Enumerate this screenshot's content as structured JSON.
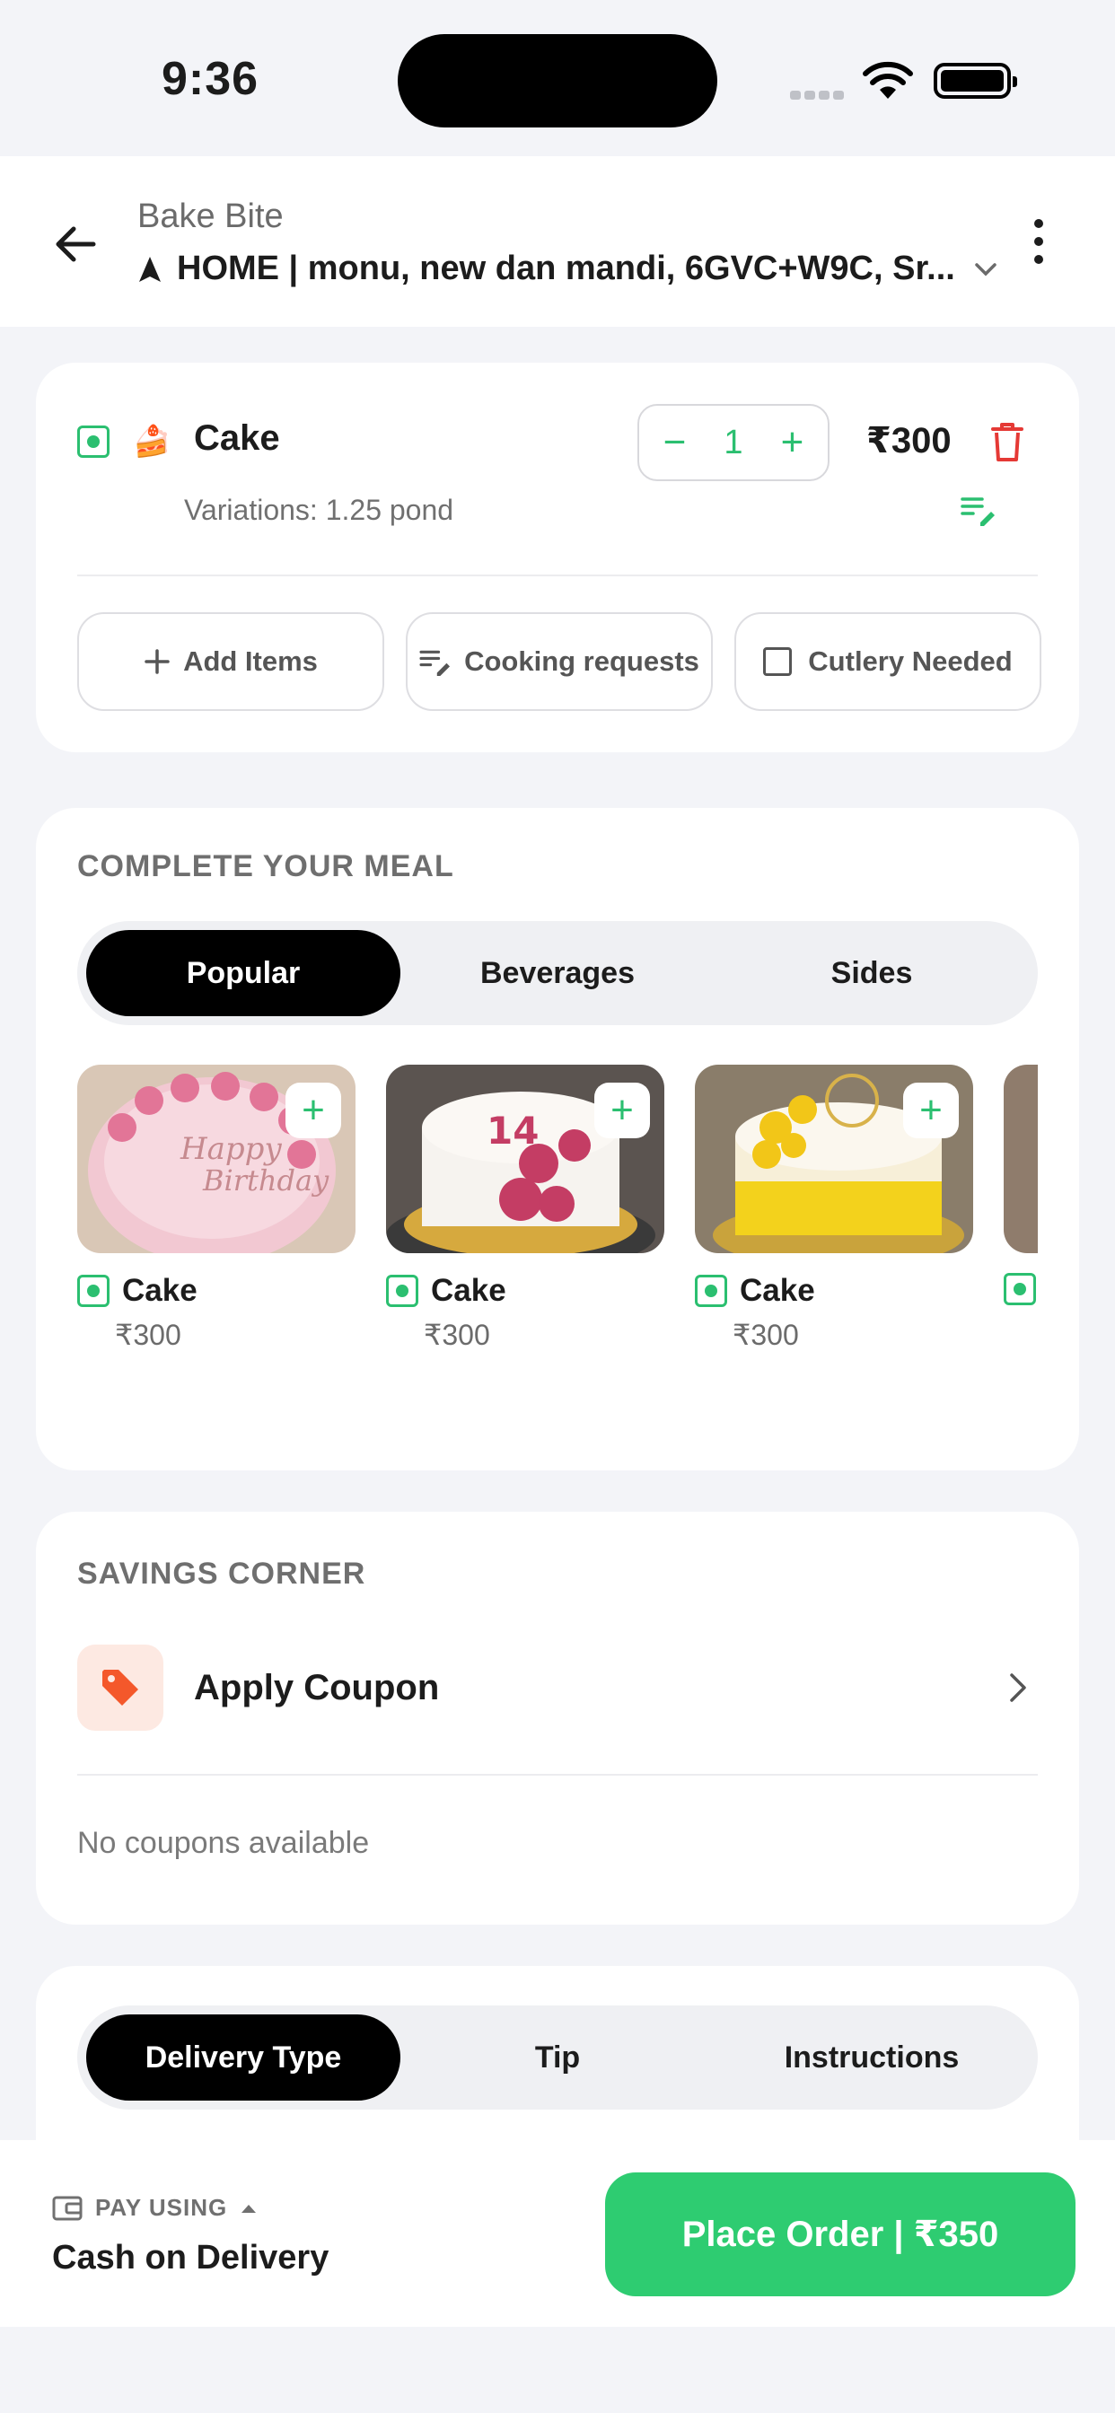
{
  "status_bar": {
    "time": "9:36"
  },
  "header": {
    "store_name": "Bake Bite",
    "address": "HOME | monu, new dan mandi, 6GVC+W9C, Sr..."
  },
  "cart": {
    "item_name": "Cake",
    "quantity": "1",
    "price": "₹300",
    "variations": "Variations: 1.25 pond",
    "actions": {
      "add_items": "Add Items",
      "cooking_requests": "Cooking requests",
      "cutlery_needed": "Cutlery Needed"
    }
  },
  "meal": {
    "title": "COMPLETE YOUR MEAL",
    "tabs": [
      {
        "label": "Popular",
        "active": true
      },
      {
        "label": "Beverages",
        "active": false
      },
      {
        "label": "Sides",
        "active": false
      }
    ],
    "items": [
      {
        "name": "Cake",
        "price": "₹300"
      },
      {
        "name": "Cake",
        "price": "₹300"
      },
      {
        "name": "Cake",
        "price": "₹300"
      }
    ]
  },
  "savings": {
    "title": "SAVINGS CORNER",
    "apply_coupon": "Apply Coupon",
    "no_coupons": "No coupons available"
  },
  "extras": {
    "tabs": [
      {
        "label": "Delivery Type",
        "active": true
      },
      {
        "label": "Tip",
        "active": false
      },
      {
        "label": "Instructions",
        "active": false
      }
    ]
  },
  "bottom": {
    "pay_using": "PAY USING",
    "pay_method": "Cash on Delivery",
    "place_order": "Place Order | ₹350"
  },
  "colors": {
    "accent_green": "#2ecc71",
    "veg_green": "#2bbf70",
    "delete_red": "#e53935",
    "coupon_orange": "#f4582b"
  }
}
